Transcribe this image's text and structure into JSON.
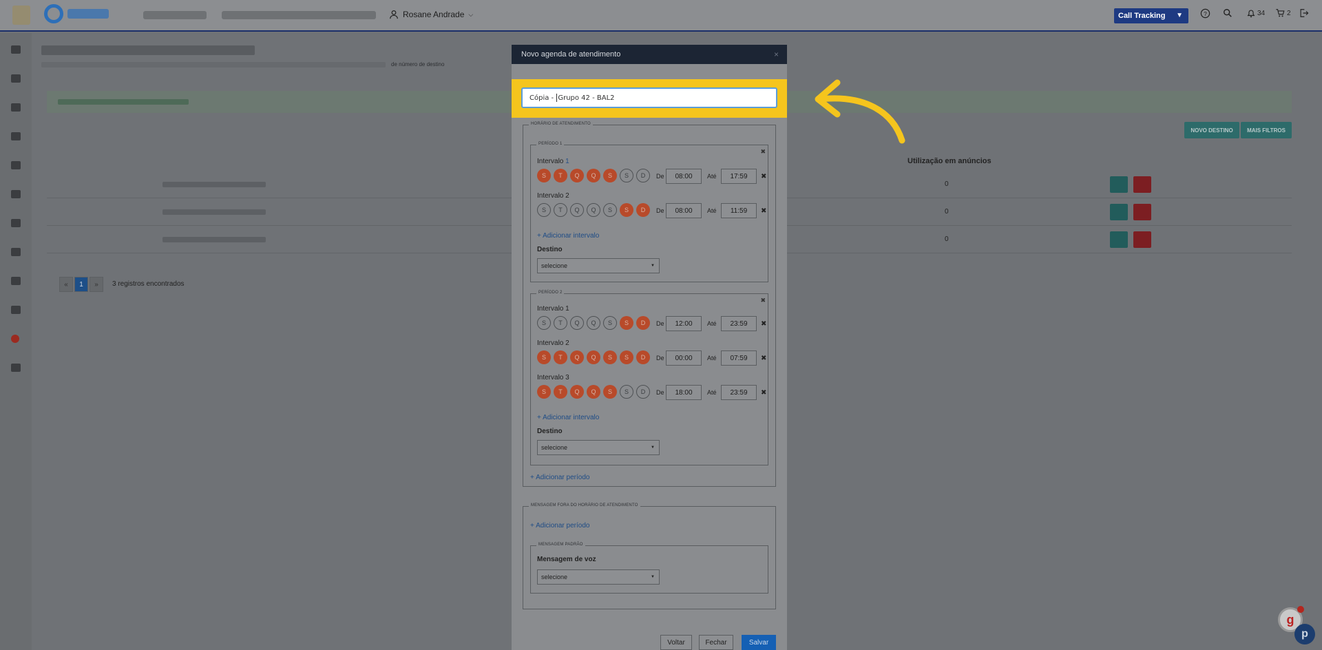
{
  "topbar": {
    "user_name": "Rosane Andrade",
    "product_button": "Call Tracking",
    "notifications_count": "34",
    "cart_count": "2"
  },
  "background_page": {
    "subtitle_tail": "de número de destino",
    "buttons": {
      "new_destination": "NOVO DESTINO",
      "more_filters": "MAIS FILTROS"
    },
    "column_header": "Utilização em anúncios",
    "rows": [
      {
        "usage": "0"
      },
      {
        "usage": "0"
      },
      {
        "usage": "0"
      }
    ],
    "pagination": {
      "prev": "«",
      "current": "1",
      "next": "»",
      "records_text": "3 registros encontrados"
    }
  },
  "modal": {
    "title": "Novo agenda de atendimento",
    "close": "×",
    "name_value_before_cursor": "Cópia - ",
    "name_value_after_cursor": "Grupo 42 - BAL2",
    "schedule_legend": "Horário de atendimento",
    "labels": {
      "from": "De",
      "to": "Até",
      "destination": "Destino",
      "select_placeholder": "selecione",
      "add_interval": "+ Adicionar intervalo",
      "add_period": "+ Adicionar período"
    },
    "periods": [
      {
        "legend": "Período 1",
        "intervals": [
          {
            "label_prefix": "Intervalo",
            "label_num": "1",
            "days": [
              "S",
              "T",
              "Q",
              "Q",
              "S",
              "S",
              "D"
            ],
            "active": [
              true,
              true,
              true,
              true,
              true,
              false,
              false
            ],
            "from": "08:00",
            "to": "17:59"
          },
          {
            "label_prefix": "Intervalo",
            "label_num": "2",
            "days": [
              "S",
              "T",
              "Q",
              "Q",
              "S",
              "S",
              "D"
            ],
            "active": [
              false,
              false,
              false,
              false,
              false,
              true,
              true
            ],
            "from": "08:00",
            "to": "11:59"
          }
        ]
      },
      {
        "legend": "Período 2",
        "intervals": [
          {
            "label_prefix": "Intervalo",
            "label_num": "1",
            "days": [
              "S",
              "T",
              "Q",
              "Q",
              "S",
              "S",
              "D"
            ],
            "active": [
              false,
              false,
              false,
              false,
              false,
              true,
              true
            ],
            "from": "12:00",
            "to": "23:59"
          },
          {
            "label_prefix": "Intervalo",
            "label_num": "2",
            "days": [
              "S",
              "T",
              "Q",
              "Q",
              "S",
              "S",
              "D"
            ],
            "active": [
              true,
              true,
              true,
              true,
              true,
              true,
              true
            ],
            "from": "00:00",
            "to": "07:59"
          },
          {
            "label_prefix": "Intervalo",
            "label_num": "3",
            "days": [
              "S",
              "T",
              "Q",
              "Q",
              "S",
              "S",
              "D"
            ],
            "active": [
              true,
              true,
              true,
              true,
              true,
              false,
              false
            ],
            "from": "18:00",
            "to": "23:59"
          }
        ]
      }
    ],
    "off_hours_legend": "Mensagem fora do horário de atendimento",
    "default_message_legend": "Mensagem padrão",
    "voice_message_label": "Mensagem de voz",
    "footer": {
      "back": "Voltar",
      "close": "Fechar",
      "save": "Salvar"
    }
  },
  "colors": {
    "highlight": "#f5c51d",
    "active_day": "#b84a2a",
    "primary": "#1560b4",
    "header": "#1c2534"
  }
}
